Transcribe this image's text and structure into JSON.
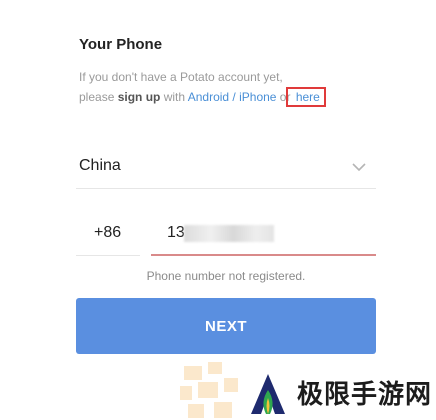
{
  "header": {
    "title": "Your Phone"
  },
  "info": {
    "line1": "If you don't have a Potato account yet,",
    "please": "please ",
    "sign_up": "sign up",
    "with": " with ",
    "android_iphone": "Android / iPhone",
    "or": " or ",
    "here": "here"
  },
  "country": {
    "value": "China",
    "icon": "chevron-down-icon"
  },
  "phone": {
    "country_code": "+86",
    "number_prefix": "13"
  },
  "error": "Phone number not registered.",
  "next_button": "NEXT",
  "watermark": {
    "text": "极限手游网",
    "icon": "flame-logo"
  },
  "colors": {
    "accent": "#5a8fe0",
    "link": "#4a8fd6",
    "error_underline": "#d98a8a",
    "highlight_box": "#e03a3a"
  }
}
